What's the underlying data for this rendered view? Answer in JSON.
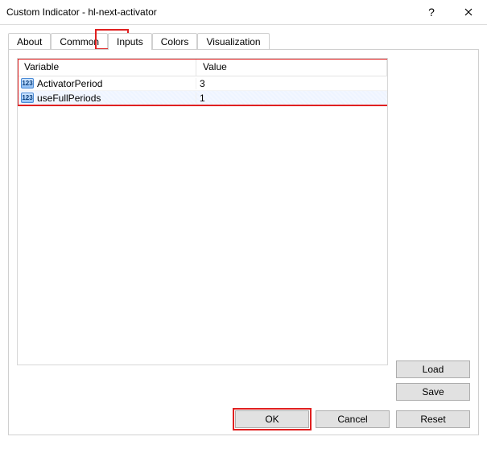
{
  "window": {
    "title": "Custom Indicator - hl-next-activator",
    "help_glyph": "?",
    "close_label": "Close"
  },
  "tabs": {
    "items": [
      {
        "label": "About"
      },
      {
        "label": "Common"
      },
      {
        "label": "Inputs",
        "active": true
      },
      {
        "label": "Colors"
      },
      {
        "label": "Visualization"
      }
    ]
  },
  "table": {
    "headers": {
      "variable": "Variable",
      "value": "Value"
    },
    "rows": [
      {
        "icon": "123",
        "variable": "ActivatorPeriod",
        "value": "3",
        "selected": false
      },
      {
        "icon": "123",
        "variable": "useFullPeriods",
        "value": "1",
        "selected": true
      }
    ]
  },
  "buttons": {
    "load": "Load",
    "save": "Save",
    "ok": "OK",
    "cancel": "Cancel",
    "reset": "Reset"
  }
}
